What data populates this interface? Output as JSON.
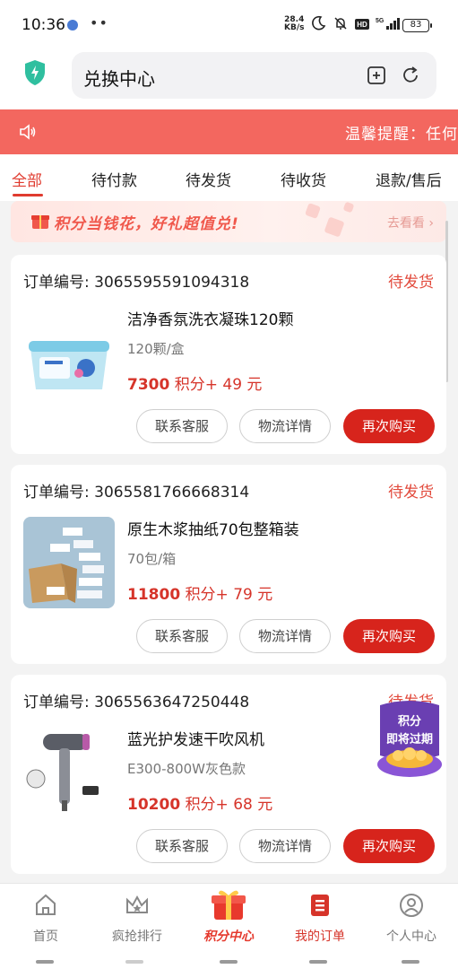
{
  "status_bar": {
    "time": "10:36",
    "network_speed_value": "28.4",
    "network_speed_unit": "KB/s",
    "battery": "83"
  },
  "header": {
    "title": "兑换中心"
  },
  "notice": {
    "text": "温馨提醒：任何"
  },
  "tabs": [
    "全部",
    "待付款",
    "待发货",
    "待收货",
    "退款/售后"
  ],
  "promo": {
    "text": "积分当钱花，好礼超值兑!",
    "action": "去看看 ›"
  },
  "orders": [
    {
      "order_no": "订单编号: 3065595591094318",
      "status": "待发货",
      "product_name": "洁净香氛洗衣凝珠120颗",
      "spec": "120颗/盒",
      "points": "7300",
      "price_suffix": "积分+ 49 元",
      "buttons": {
        "service": "联系客服",
        "logistics": "物流详情",
        "rebuy": "再次购买"
      }
    },
    {
      "order_no": "订单编号: 3065581766668314",
      "status": "待发货",
      "product_name": "原生木浆抽纸70包整箱装",
      "spec": "70包/箱",
      "points": "11800",
      "price_suffix": "积分+ 79 元",
      "buttons": {
        "service": "联系客服",
        "logistics": "物流详情",
        "rebuy": "再次购买"
      }
    },
    {
      "order_no": "订单编号: 3065563647250448",
      "status": "待发货",
      "product_name": "蓝光护发速干吹风机",
      "spec": "E300-800W灰色款",
      "points": "10200",
      "price_suffix": "积分+ 68 元",
      "buttons": {
        "service": "联系客服",
        "logistics": "物流详情",
        "rebuy": "再次购买"
      }
    }
  ],
  "floating_badge": {
    "line1": "积分",
    "line2": "即将过期"
  },
  "bottom_nav": [
    "首页",
    "疯抢排行",
    "积分中心",
    "我的订单",
    "个人中心"
  ],
  "colors": {
    "accent": "#d7241c",
    "notice_bg": "#f3675f",
    "status_text": "#e24a3c"
  }
}
